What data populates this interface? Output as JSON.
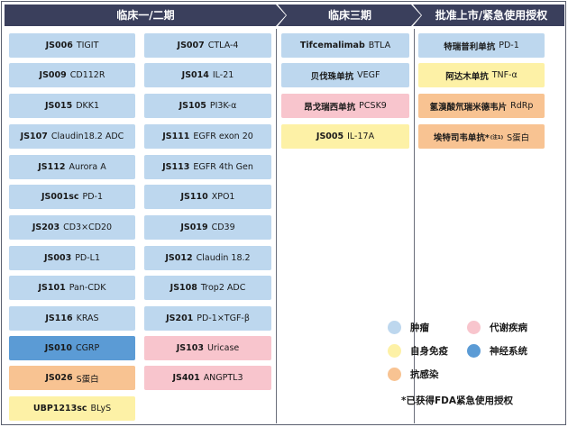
{
  "phases": [
    {
      "title": "临床一/二期"
    },
    {
      "title": "临床三期"
    },
    {
      "title": "批准上市/紧急使用授权"
    }
  ],
  "colors": {
    "header": "#3a3f5c",
    "tumor": "#bdd7ee",
    "neuro": "#5b9bd5",
    "metabolic": "#f8c5cd",
    "autoimmune": "#fdf1a6",
    "anti_infection": "#f8c392"
  },
  "phase1": {
    "left": [
      {
        "code": "JS006",
        "name": "TIGIT",
        "category": "tumor"
      },
      {
        "code": "JS009",
        "name": "CD112R",
        "category": "tumor"
      },
      {
        "code": "JS015",
        "name": "DKK1",
        "category": "tumor"
      },
      {
        "code": "JS107",
        "name": "Claudin18.2 ADC",
        "category": "tumor"
      },
      {
        "code": "JS112",
        "name": "Aurora A",
        "category": "tumor"
      },
      {
        "code": "JS001sc",
        "name": "PD-1",
        "category": "tumor"
      },
      {
        "code": "JS203",
        "name": "CD3×CD20",
        "category": "tumor"
      },
      {
        "code": "JS003",
        "name": "PD-L1",
        "category": "tumor"
      },
      {
        "code": "JS101",
        "name": "Pan-CDK",
        "category": "tumor"
      },
      {
        "code": "JS116",
        "name": "KRAS",
        "category": "tumor"
      },
      {
        "code": "JS010",
        "name": "CGRP",
        "category": "neuro"
      },
      {
        "code": "JS026",
        "name": "S蛋白",
        "category": "anti_infection"
      },
      {
        "code": "UBP1213sc",
        "name": "BLyS",
        "category": "autoimmune"
      }
    ],
    "right": [
      {
        "code": "JS007",
        "name": "CTLA-4",
        "category": "tumor"
      },
      {
        "code": "JS014",
        "name": "IL-21",
        "category": "tumor"
      },
      {
        "code": "JS105",
        "name": "PI3K-α",
        "category": "tumor"
      },
      {
        "code": "JS111",
        "name": "EGFR exon 20",
        "category": "tumor"
      },
      {
        "code": "JS113",
        "name": "EGFR 4th Gen",
        "category": "tumor"
      },
      {
        "code": "JS110",
        "name": "XPO1",
        "category": "tumor"
      },
      {
        "code": "JS019",
        "name": "CD39",
        "category": "tumor"
      },
      {
        "code": "JS012",
        "name": "Claudin 18.2",
        "category": "tumor"
      },
      {
        "code": "JS108",
        "name": "Trop2 ADC",
        "category": "tumor"
      },
      {
        "code": "JS201",
        "name": "PD-1×TGF-β",
        "category": "tumor"
      },
      {
        "code": "JS103",
        "name": "Uricase",
        "category": "metabolic"
      },
      {
        "code": "JS401",
        "name": "ANGPTL3",
        "category": "metabolic"
      }
    ]
  },
  "phase3": [
    {
      "code": "Tifcemalimab",
      "name": "BTLA",
      "category": "tumor"
    },
    {
      "code": "贝伐珠单抗",
      "name": "VEGF",
      "category": "tumor"
    },
    {
      "code": "昂戈瑞西单抗",
      "name": "PCSK9",
      "category": "metabolic"
    },
    {
      "code": "JS005",
      "name": "IL-17A",
      "category": "autoimmune"
    }
  ],
  "approved": [
    {
      "code": "特瑞普利单抗",
      "name": "PD-1",
      "category": "tumor"
    },
    {
      "code": "阿达木单抗",
      "name": "TNF-α",
      "category": "autoimmune"
    },
    {
      "code": "氢溴酸氘瑞米德韦片",
      "name": "RdRp",
      "category": "anti_infection"
    },
    {
      "code": "埃特司韦单抗*",
      "note": "(注1)",
      "name": "S蛋白",
      "category": "anti_infection"
    }
  ],
  "legend": [
    {
      "label": "肿瘤",
      "color": "#bdd7ee"
    },
    {
      "label": "代谢疾病",
      "color": "#f8c5cd"
    },
    {
      "label": "自身免疫",
      "color": "#fdf1a6"
    },
    {
      "label": "神经系统",
      "color": "#5b9bd5"
    },
    {
      "label": "抗感染",
      "color": "#f8c392"
    }
  ],
  "footnote": "*已获得FDA紧急使用授权"
}
